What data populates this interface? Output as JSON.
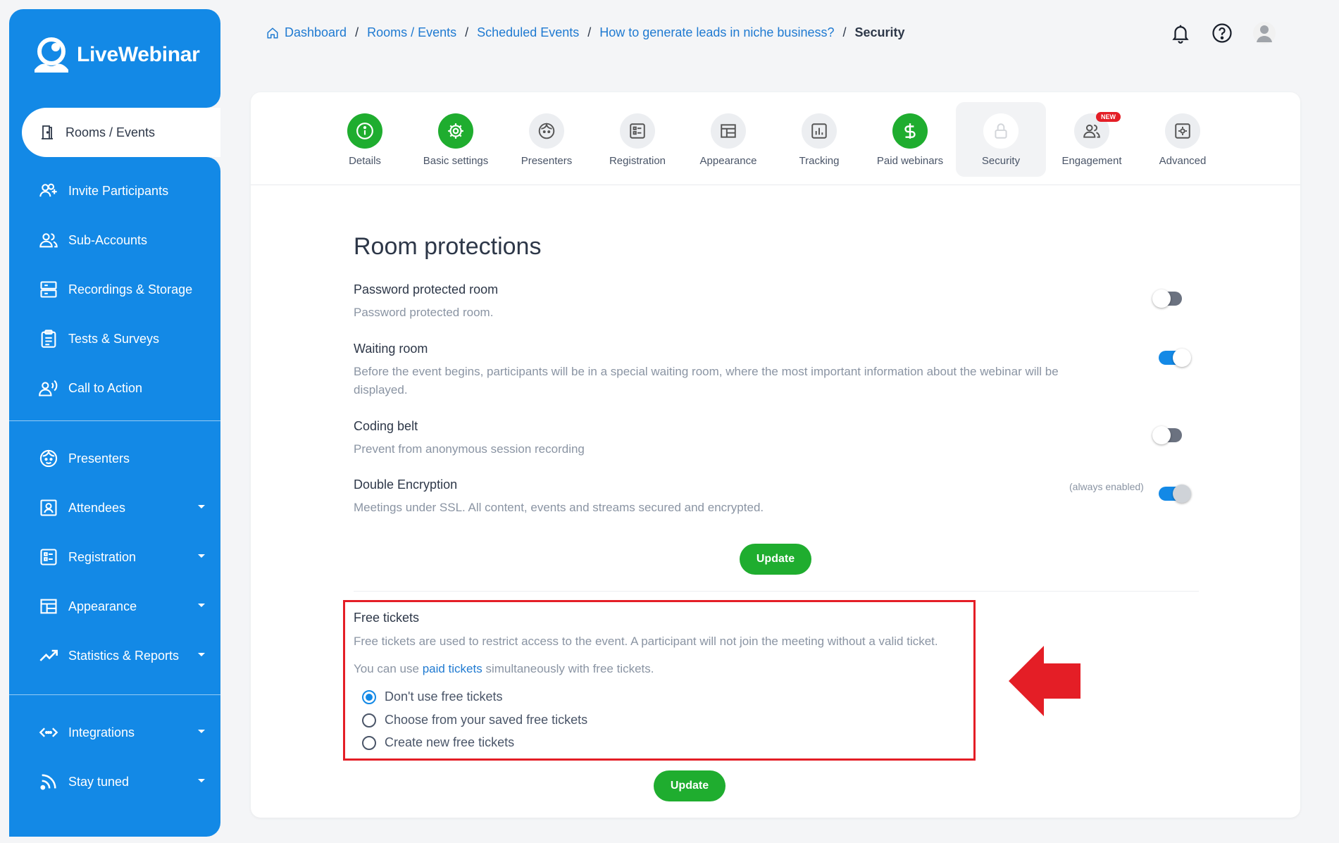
{
  "brand": {
    "name": "LiveWebinar"
  },
  "sidebar": {
    "active": {
      "label": "Rooms / Events",
      "icon": "door-icon"
    },
    "items": [
      {
        "label": "Invite Participants",
        "icon": "invite-users-icon"
      },
      {
        "label": "Sub-Accounts",
        "icon": "users-icon"
      },
      {
        "label": "Recordings & Storage",
        "icon": "storage-icon"
      },
      {
        "label": "Tests & Surveys",
        "icon": "clipboard-icon"
      },
      {
        "label": "Call to Action",
        "icon": "speaking-user-icon"
      },
      {
        "label": "Presenters",
        "icon": "presenter-face-icon"
      },
      {
        "label": "Attendees",
        "icon": "attendee-card-icon"
      },
      {
        "label": "Registration",
        "icon": "registration-form-icon"
      },
      {
        "label": "Appearance",
        "icon": "layout-icon"
      },
      {
        "label": "Statistics & Reports",
        "icon": "trend-icon"
      },
      {
        "label": "Integrations",
        "icon": "code-icon"
      },
      {
        "label": "Stay tuned",
        "icon": "rss-icon"
      }
    ]
  },
  "breadcrumb": {
    "items": [
      "Dashboard",
      "Rooms / Events",
      "Scheduled Events",
      "How to generate leads in niche business?"
    ],
    "current": "Security",
    "separator": "/"
  },
  "header_icons": [
    "bell-icon",
    "help-icon",
    "avatar"
  ],
  "tabs": [
    {
      "label": "Details",
      "icon": "info-icon",
      "state": "done"
    },
    {
      "label": "Basic settings",
      "icon": "gear-icon",
      "state": "done"
    },
    {
      "label": "Presenters",
      "icon": "presenter-face-icon",
      "state": "default"
    },
    {
      "label": "Registration",
      "icon": "registration-form-icon",
      "state": "default"
    },
    {
      "label": "Appearance",
      "icon": "layout-icon",
      "state": "default"
    },
    {
      "label": "Tracking",
      "icon": "bar-chart-icon",
      "state": "default"
    },
    {
      "label": "Paid webinars",
      "icon": "dollar-icon",
      "state": "done"
    },
    {
      "label": "Security",
      "icon": "lock-icon",
      "state": "active"
    },
    {
      "label": "Engagement",
      "icon": "users-icon",
      "state": "default",
      "badge": "NEW"
    },
    {
      "label": "Advanced",
      "icon": "gear-box-icon",
      "state": "default"
    }
  ],
  "room_protections": {
    "title": "Room protections",
    "options": [
      {
        "title": "Password protected room",
        "description": "Password protected room.",
        "enabled": false
      },
      {
        "title": "Waiting room",
        "description": "Before the event begins, participants will be in a special waiting room, where the most important information about the webinar will be displayed.",
        "enabled": true
      },
      {
        "title": "Coding belt",
        "description": "Prevent from anonymous session recording",
        "enabled": false
      },
      {
        "title": "Double Encryption",
        "description": "Meetings under SSL. All content, events and streams secured and encrypted.",
        "enabled": true,
        "note": "(always enabled)"
      }
    ],
    "update_label": "Update"
  },
  "free_tickets": {
    "title": "Free tickets",
    "description": "Free tickets are used to restrict access to the event. A participant will not join the meeting without a valid ticket.",
    "paid_prefix": "You can use ",
    "paid_link": "paid tickets",
    "paid_suffix": " simultaneously with free tickets.",
    "options": [
      "Don't use free tickets",
      "Choose from your saved free tickets",
      "Create new free tickets"
    ],
    "selected": 0,
    "update_label": "Update"
  },
  "colors": {
    "brand_blue": "#1389e6",
    "success_green": "#1fad2f",
    "highlight_red": "#e41e26",
    "link_blue": "#1f7ad1"
  }
}
